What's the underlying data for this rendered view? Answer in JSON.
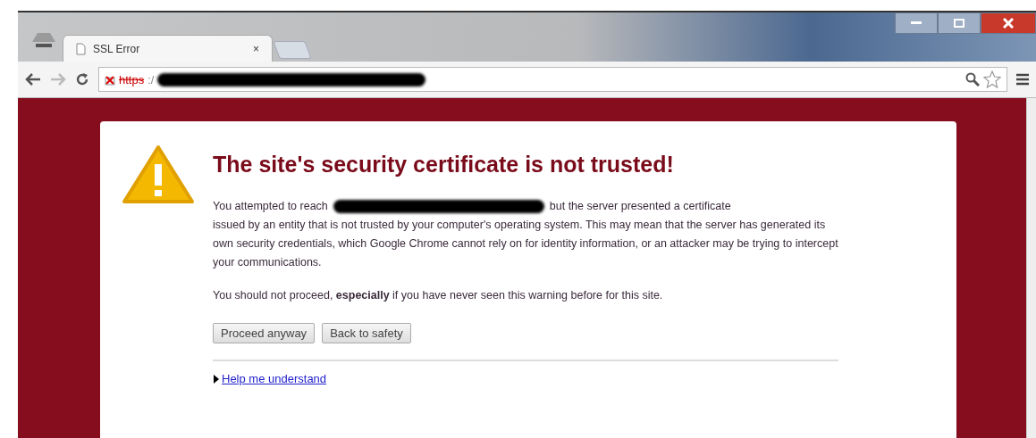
{
  "tabs": [
    {
      "title": "SSL Error",
      "selected": true,
      "close": "×"
    }
  ],
  "address_bar": {
    "scheme": "https",
    "rest": ":/",
    "insecure": true
  },
  "warning": {
    "title": "The site's security certificate is not trusted!",
    "intro": "You attempted to reach",
    "body_first": "but the server presented a certificate",
    "body": "issued by an entity that is not trusted by your computer's operating system. This may mean that the server has generated its own security credentials, which Google Chrome cannot rely on for identity information, or an attacker may be trying to intercept your communications.",
    "advice": "You should not proceed, **especially** if you have never seen this warning before for this site.",
    "buttons": [
      "Proceed anyway",
      "Back to safety"
    ],
    "help_link": {
      "label": "Help me understand",
      "expanded": false
    }
  }
}
